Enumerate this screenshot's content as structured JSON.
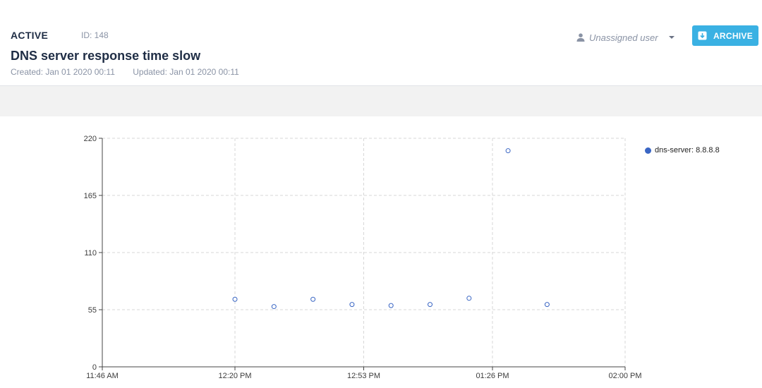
{
  "header": {
    "status": "ACTIVE",
    "id_text": "ID: 148",
    "title": "DNS server response time slow",
    "created": "Created: Jan 01 2020 00:11",
    "updated": "Updated: Jan 01 2020 00:11",
    "assignee": "Unassigned user",
    "archive_label": "ARCHIVE"
  },
  "icons": {
    "assignee": "user-icon",
    "dropdown": "caret-down-icon",
    "archive": "archive-icon"
  },
  "colors": {
    "archive_button": "#3ab1e3",
    "series": "#3a66c4",
    "band": "#f2f2f2"
  },
  "chart_data": {
    "type": "scatter",
    "xlabel": "",
    "ylabel": "",
    "x_ticks": [
      "11:46 AM",
      "12:20 PM",
      "12:53 PM",
      "01:26 PM",
      "02:00 PM"
    ],
    "xlim": [
      "11:46 AM",
      "02:00 PM"
    ],
    "ylim": [
      0,
      220
    ],
    "y_ticks": [
      0,
      55,
      110,
      165,
      220
    ],
    "grid": true,
    "legend_position": "top-right",
    "series": [
      {
        "name": "dns-server: 8.8.8.8",
        "points": [
          {
            "x": "12:20 PM",
            "y": 65
          },
          {
            "x": "12:30 PM",
            "y": 58
          },
          {
            "x": "12:40 PM",
            "y": 65
          },
          {
            "x": "12:50 PM",
            "y": 60
          },
          {
            "x": "01:00 PM",
            "y": 59
          },
          {
            "x": "01:10 PM",
            "y": 60
          },
          {
            "x": "01:20 PM",
            "y": 66
          },
          {
            "x": "01:30 PM",
            "y": 208
          },
          {
            "x": "01:40 PM",
            "y": 60
          }
        ]
      }
    ]
  }
}
